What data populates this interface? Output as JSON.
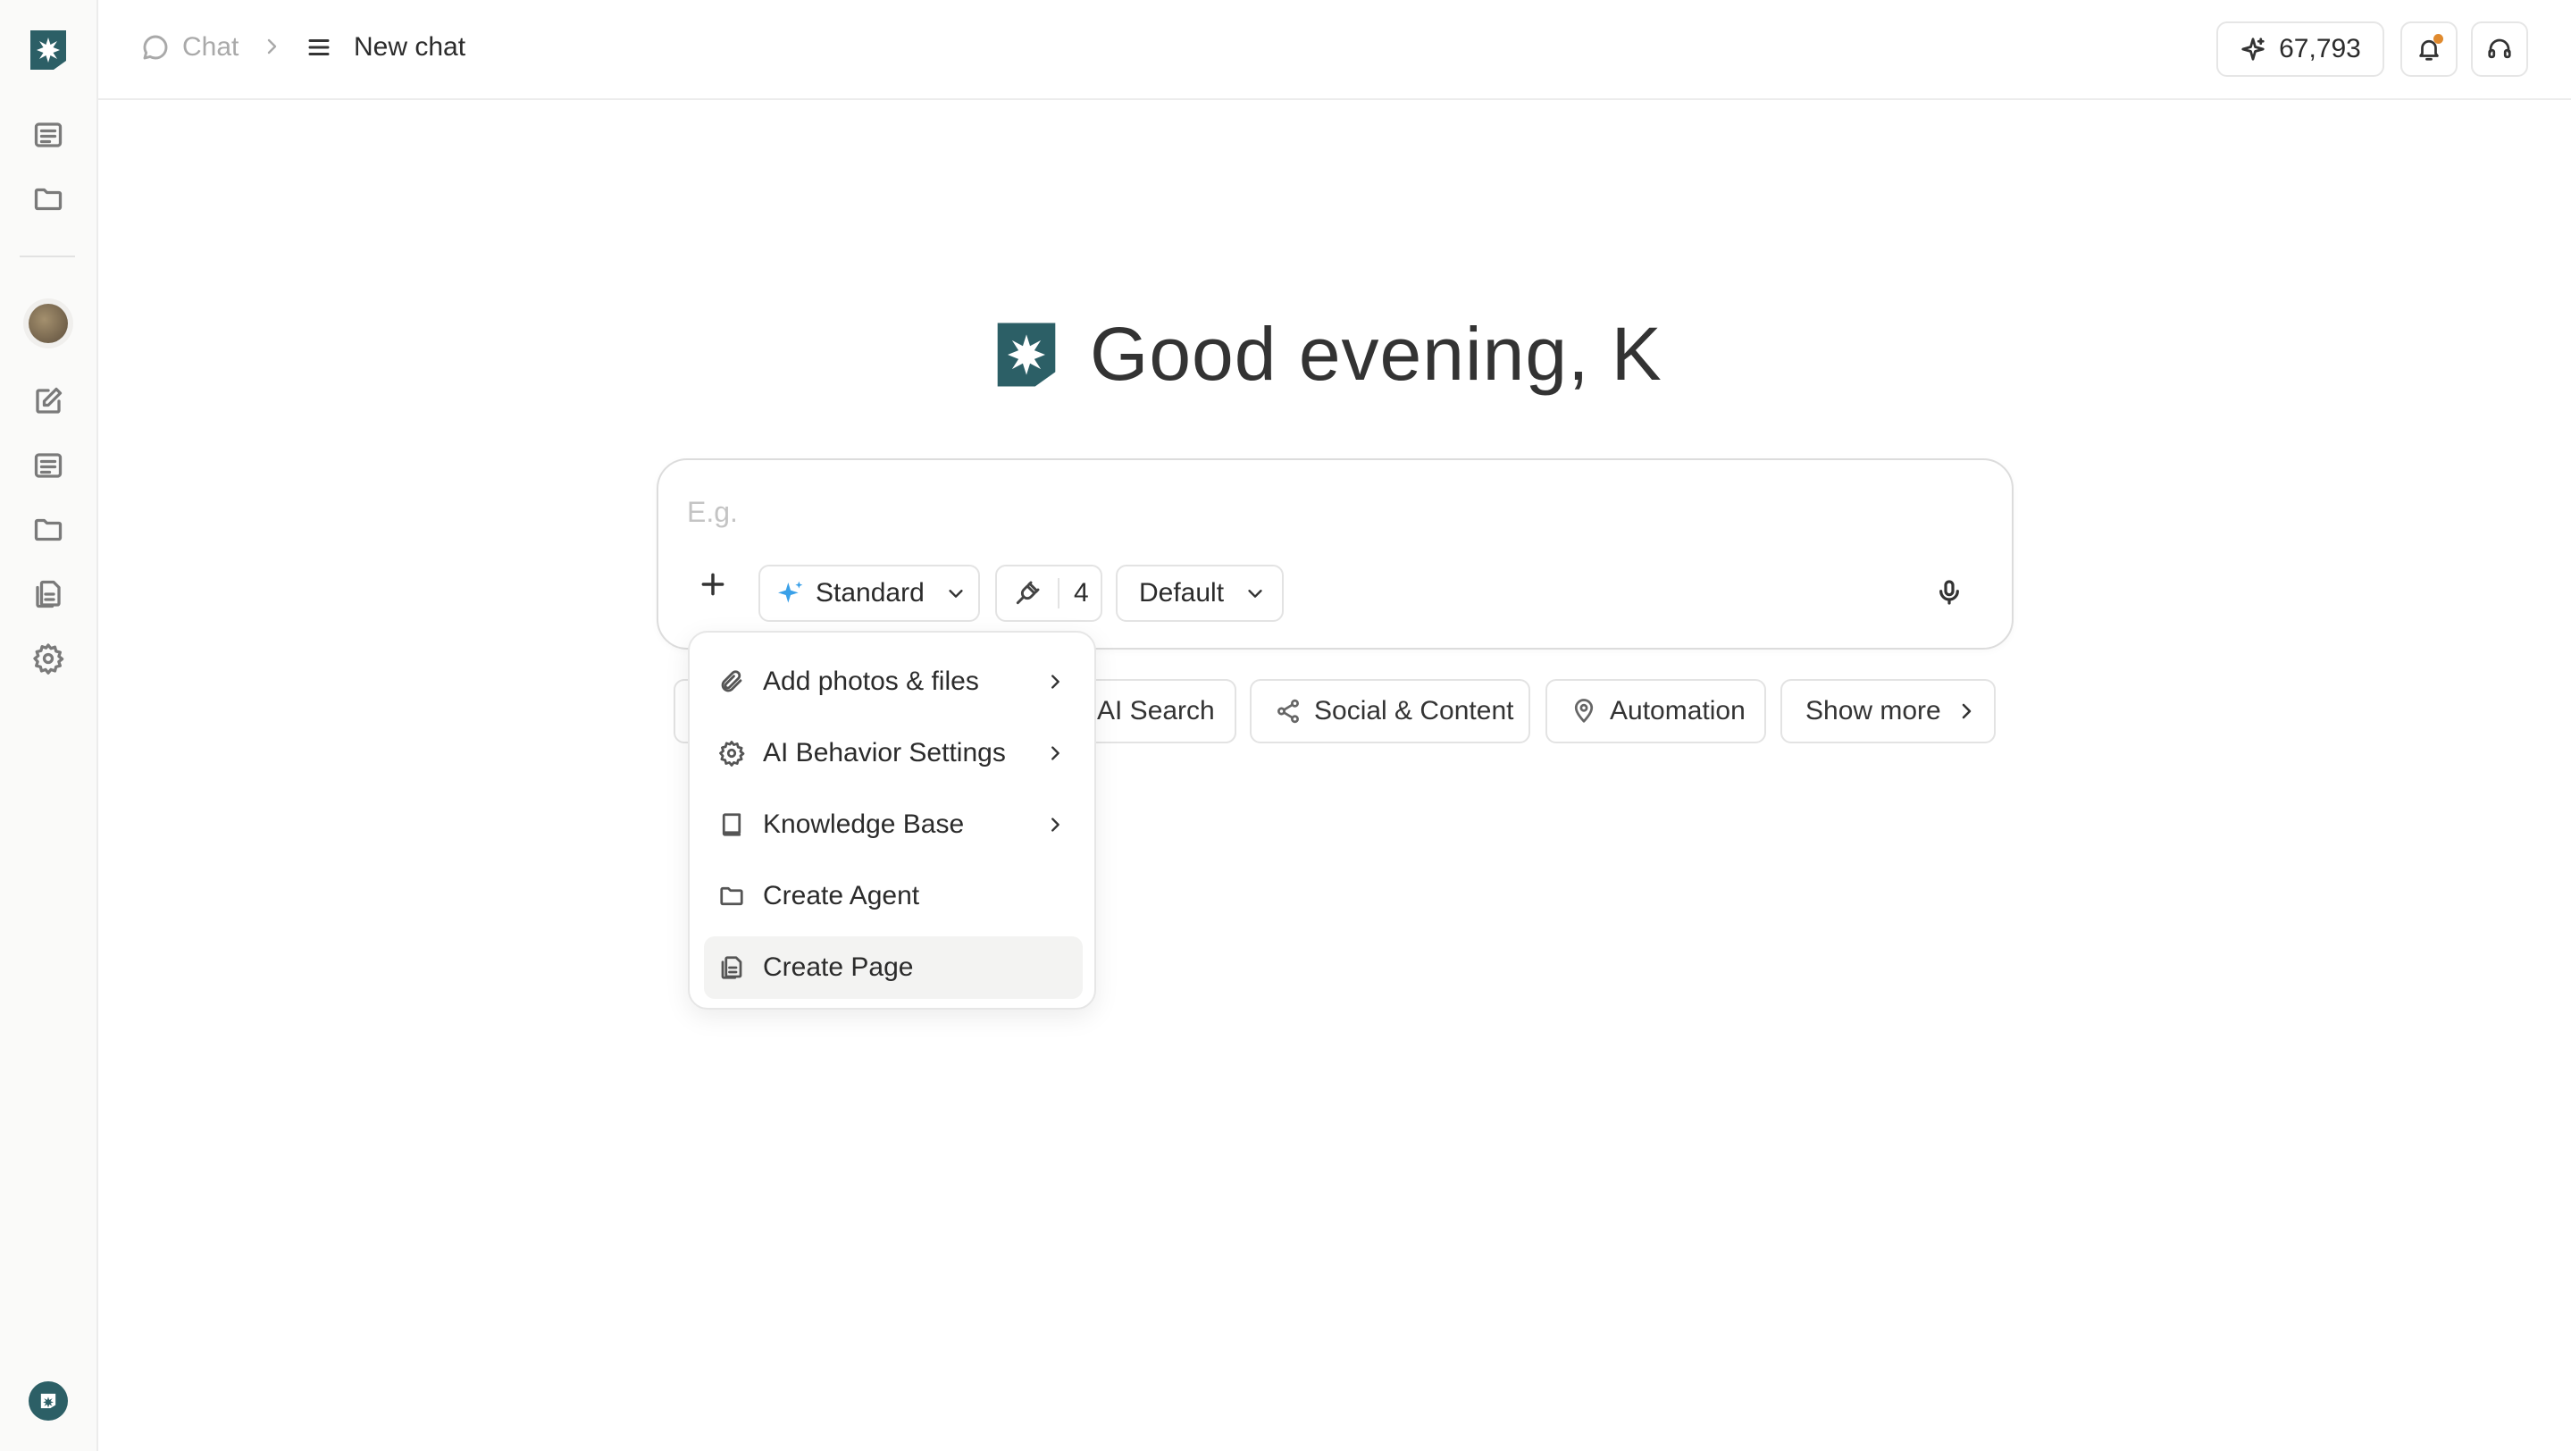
{
  "header": {
    "breadcrumb_root": "Chat",
    "breadcrumb_current": "New chat",
    "credits": "67,793",
    "notification_dot_color": "#e08a2e"
  },
  "brand": {
    "accent": "#2c5f66"
  },
  "greeting": {
    "text": "Good evening, K"
  },
  "composer": {
    "placeholder": "E.g.",
    "mode_label": "Standard",
    "tools_count": "4",
    "preset_label": "Default"
  },
  "chips": [
    {
      "label": "AI Search"
    },
    {
      "label": "Social & Content",
      "icon": "share-icon"
    },
    {
      "label": "Automation",
      "icon": "location-pin-icon"
    },
    {
      "label": "Show more",
      "icon": "chevron-right-icon"
    }
  ],
  "menu": {
    "items": [
      {
        "label": "Add photos & files",
        "icon": "paperclip-icon",
        "submenu": true
      },
      {
        "label": "AI Behavior Settings",
        "icon": "gear-icon",
        "submenu": true
      },
      {
        "label": "Knowledge Base",
        "icon": "book-icon",
        "submenu": true
      },
      {
        "label": "Create Agent",
        "icon": "folder-icon",
        "submenu": false
      },
      {
        "label": "Create Page",
        "icon": "pages-icon",
        "submenu": false,
        "highlighted": true
      }
    ]
  },
  "sidebar": {
    "items": [
      {
        "icon": "list-icon"
      },
      {
        "icon": "folder-icon"
      },
      {
        "icon": "avatar"
      },
      {
        "icon": "edit-icon"
      },
      {
        "icon": "list-icon"
      },
      {
        "icon": "folder-icon"
      },
      {
        "icon": "pages-icon"
      },
      {
        "icon": "gear-icon"
      }
    ]
  }
}
